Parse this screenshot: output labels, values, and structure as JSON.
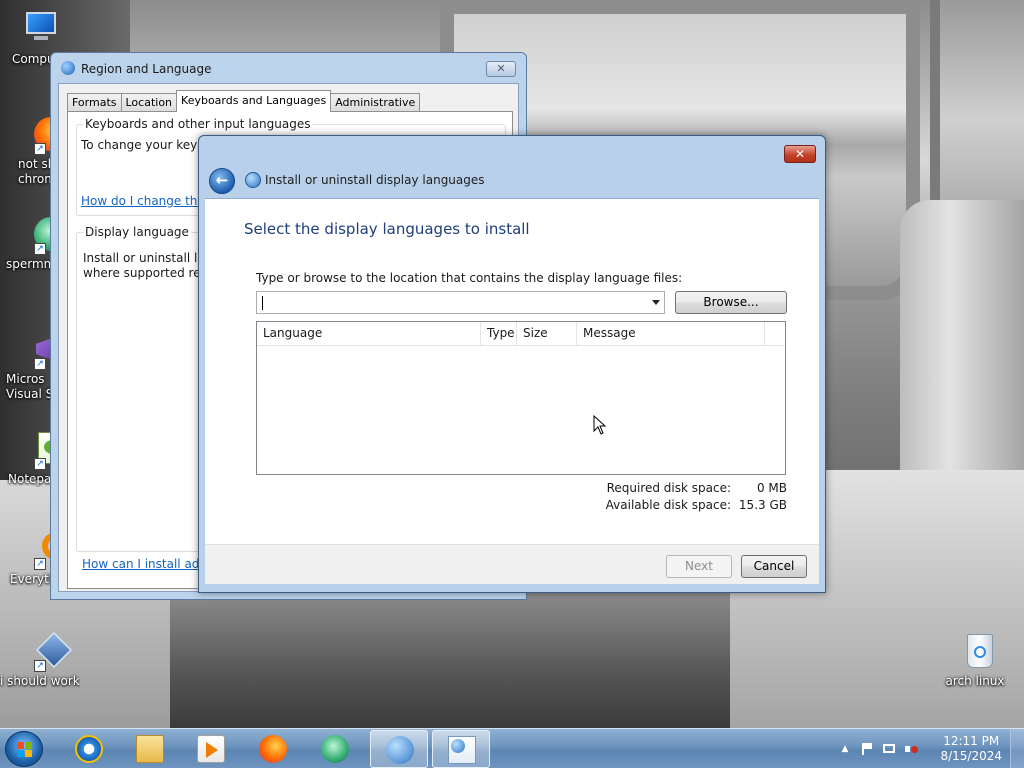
{
  "desktop": {
    "icons": [
      {
        "label": "Compu",
        "name": "computer"
      },
      {
        "label": "not sh\nchrom",
        "name": "chrome"
      },
      {
        "label": "spermm",
        "name": "spermm"
      },
      {
        "label": "Micros\nVisual St",
        "name": "visual-studio"
      },
      {
        "label": "Notepac",
        "name": "notepad"
      },
      {
        "label": "Everyth",
        "name": "everything"
      },
      {
        "label": "i should work",
        "name": "virtualbox"
      },
      {
        "label": "arch linux",
        "name": "recycle-bin"
      }
    ]
  },
  "region_window": {
    "title": "Region and Language",
    "close_glyph": "✕",
    "tabs": [
      "Formats",
      "Location",
      "Keyboards and Languages",
      "Administrative"
    ],
    "keyboards_group_title": "Keyboards and other input languages",
    "keyboards_text": "To change your keyb",
    "keyboards_link": "How do I change the",
    "display_group_title": "Display language",
    "display_text_1": "Install or uninstall la",
    "display_text_2": "where supported re",
    "bottom_link": "How can I install additi"
  },
  "install_dialog": {
    "title": "Install or uninstall display languages",
    "close_glyph": "✕",
    "back_glyph": "←",
    "heading": "Select the display languages to install",
    "prompt": "Type or browse to the location that contains the display language files:",
    "location_value": "",
    "browse_label": "Browse...",
    "columns": [
      "Language",
      "Type",
      "Size",
      "Message"
    ],
    "rows": [],
    "required_label": "Required disk space:",
    "required_value": "0 MB",
    "available_label": "Available disk space:",
    "available_value": "15.3 GB",
    "next_label": "Next",
    "cancel_label": "Cancel"
  },
  "taskbar": {
    "apps": [
      "internet-explorer",
      "file-explorer",
      "media-player",
      "firefox",
      "spermm",
      "region-and-language",
      "install-display-languages"
    ],
    "time": "12:11 PM",
    "date": "8/15/2024",
    "tray_chevron": "▲"
  }
}
